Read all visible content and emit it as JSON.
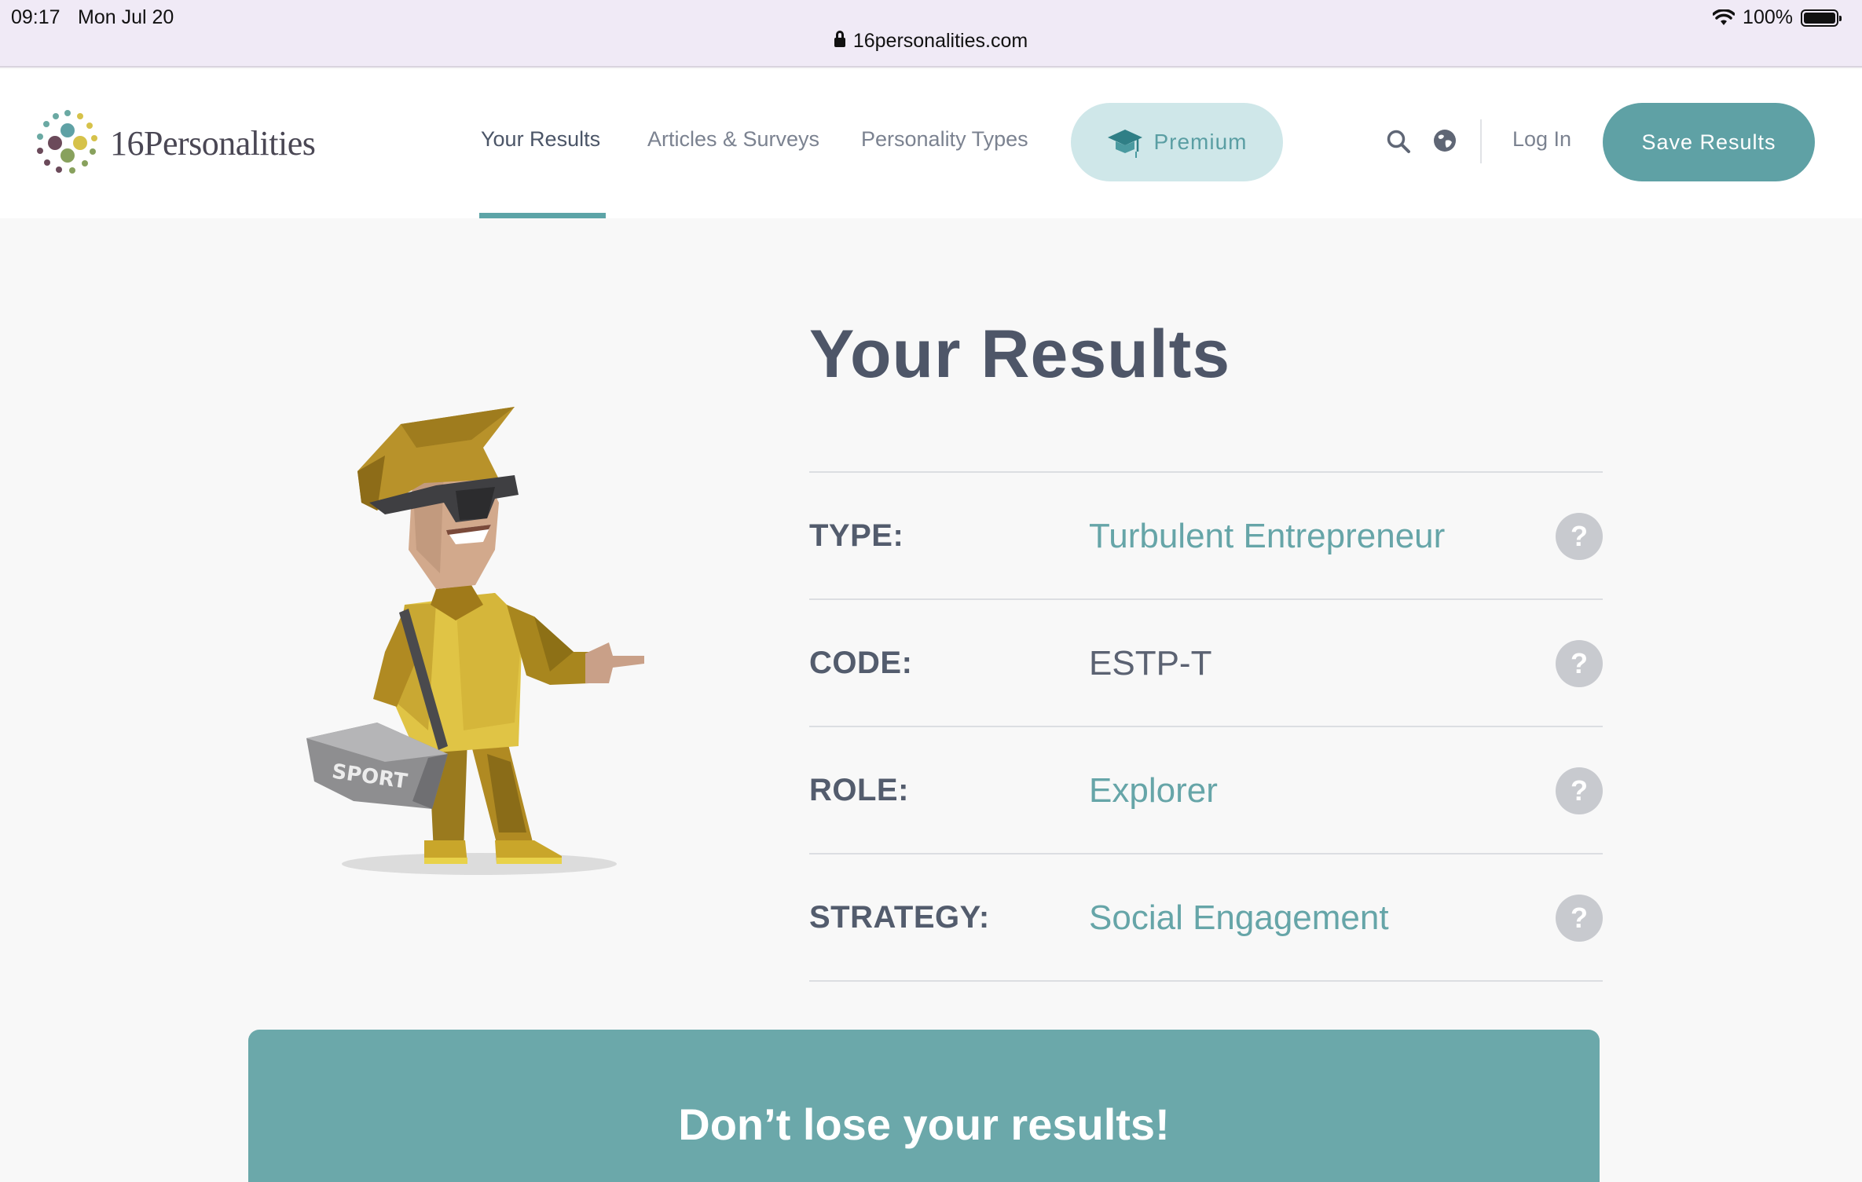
{
  "status_bar": {
    "time": "09:17",
    "date": "Mon Jul 20",
    "url": "16personalities.com",
    "battery": "100%"
  },
  "nav": {
    "logo_text": "16Personalities",
    "links": [
      "Your Results",
      "Articles & Surveys",
      "Personality Types"
    ],
    "active_link": "Your Results",
    "premium_label": "Premium",
    "login_label": "Log In",
    "save_label": "Save Results"
  },
  "main": {
    "title": "Your Results",
    "rows": [
      {
        "label": "TYPE:",
        "value": "Turbulent Entrepreneur"
      },
      {
        "label": "CODE:",
        "value": "ESTP-T"
      },
      {
        "label": "ROLE:",
        "value": "Explorer"
      },
      {
        "label": "STRATEGY:",
        "value": "Social Engagement"
      }
    ],
    "help_symbol": "?",
    "figure_bag_text": "SPORT"
  },
  "banner": {
    "text": "Don’t lose your results!"
  },
  "colors": {
    "accent": "#5fa1a5",
    "premium_bg": "#cfe7e9",
    "banner_bg": "#6ba8aa"
  }
}
